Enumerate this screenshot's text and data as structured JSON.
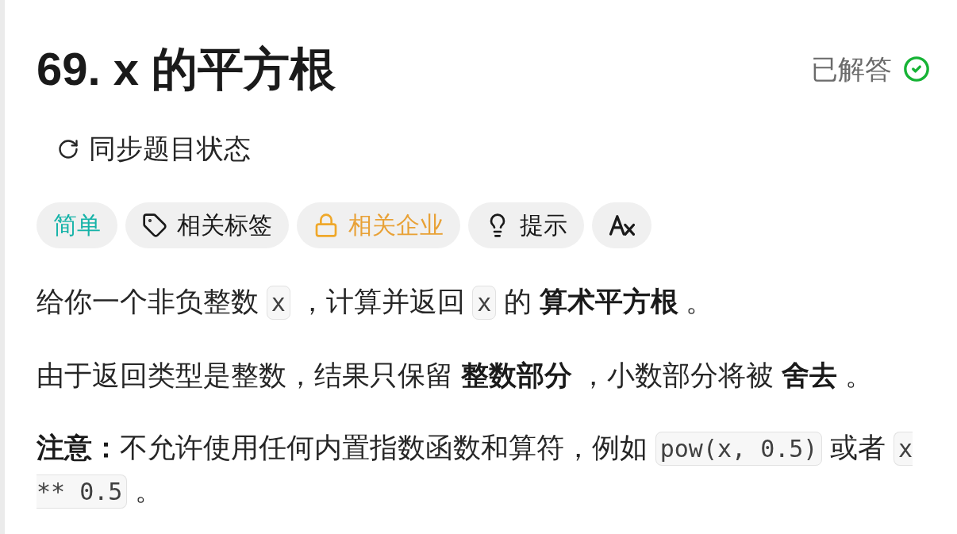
{
  "problem": {
    "title": "69. x 的平方根",
    "status": {
      "label": "已解答",
      "solved": true
    }
  },
  "sync_button": {
    "label": "同步题目状态"
  },
  "chips": [
    {
      "kind": "difficulty",
      "label": "简单"
    },
    {
      "kind": "tags",
      "label": "相关标签"
    },
    {
      "kind": "companies",
      "label": "相关企业",
      "locked": true
    },
    {
      "kind": "hint",
      "label": "提示"
    },
    {
      "kind": "translate"
    }
  ],
  "description": [
    {
      "segments": [
        {
          "kind": "text",
          "text": "给你一个非负整数 "
        },
        {
          "kind": "code",
          "text": "x"
        },
        {
          "kind": "text",
          "text": " ，计算并返回 "
        },
        {
          "kind": "code",
          "text": "x"
        },
        {
          "kind": "text",
          "text": " 的 "
        },
        {
          "kind": "bold",
          "text": "算术平方根"
        },
        {
          "kind": "text",
          "text": " 。"
        }
      ]
    },
    {
      "segments": [
        {
          "kind": "text",
          "text": "由于返回类型是整数，结果只保留 "
        },
        {
          "kind": "bold",
          "text": "整数部分"
        },
        {
          "kind": "text",
          "text": " ，小数部分将被 "
        },
        {
          "kind": "bold",
          "text": "舍去"
        },
        {
          "kind": "text",
          "text": " 。"
        }
      ]
    },
    {
      "segments": [
        {
          "kind": "bold",
          "text": "注意："
        },
        {
          "kind": "text",
          "text": "不允许使用任何内置指数函数和算符，例如 "
        },
        {
          "kind": "code",
          "text": "pow(x, 0.5)"
        },
        {
          "kind": "text",
          "text": " 或者 "
        },
        {
          "kind": "code",
          "text": "x ** 0.5"
        },
        {
          "kind": "text",
          "text": " 。"
        }
      ]
    }
  ]
}
